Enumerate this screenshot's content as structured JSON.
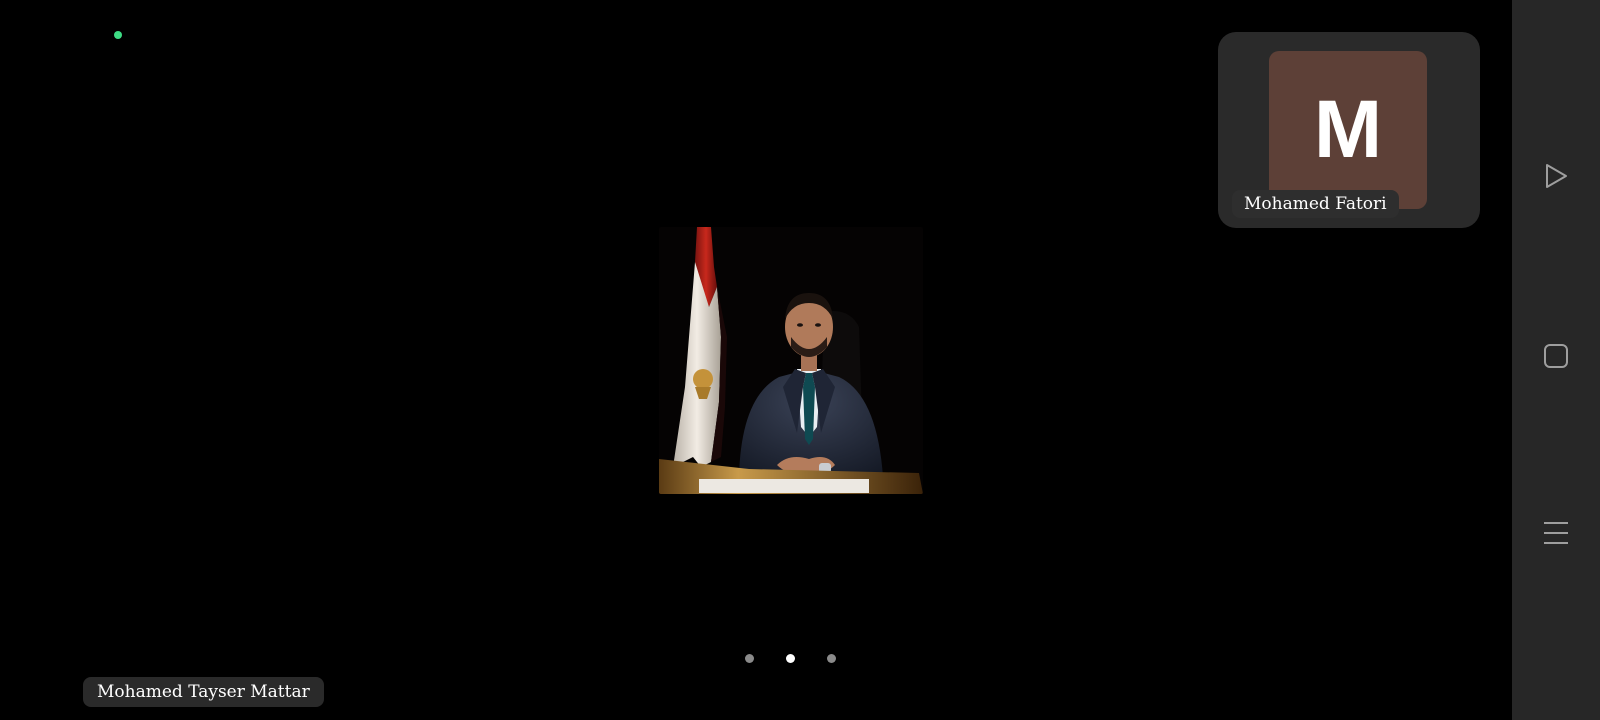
{
  "call": {
    "main_participant_name": "Mohamed Tayser Mattar",
    "secondary_participant_name": "Mohamed Fatori",
    "secondary_avatar_initial": "M",
    "secondary_avatar_color": "#5d4037",
    "status_dot_color": "#3ddc84",
    "pager": {
      "total": 3,
      "current": 2
    }
  },
  "nav_bar": {
    "buttons": [
      "back-icon",
      "home-icon",
      "recents-icon"
    ]
  }
}
